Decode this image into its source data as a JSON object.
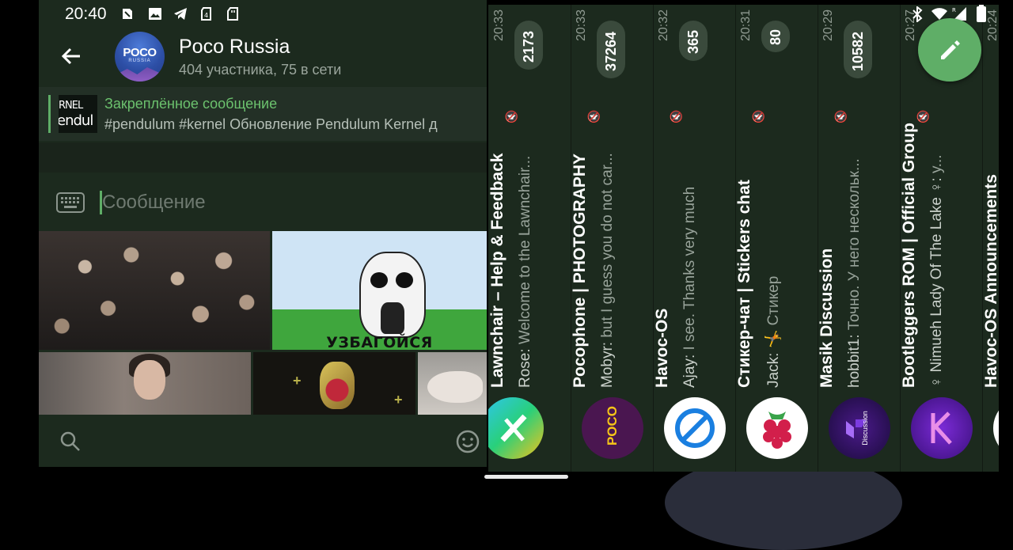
{
  "status_left": {
    "time": "20:40"
  },
  "chat": {
    "title": "Poco Russia",
    "subtitle": "404 участника, 75 в сети",
    "avatar_text": "POCO",
    "avatar_subtext": "RUSSIA"
  },
  "pinned": {
    "title": "Закреплённое сообщение",
    "text": "#pendulum #kernel  Обновление Pendulum Kernel д",
    "thumb_line1": "RNEL",
    "thumb_line2": "endul"
  },
  "composer": {
    "placeholder": "Сообщение"
  },
  "gifs": {
    "caption": "УЗБАГОЙСЯ"
  },
  "chat_list": [
    {
      "name": "Lawnchair – Help & Feedback",
      "sender": "Rose:",
      "preview": "Welcome to the Lawnchair...",
      "time": "20:33",
      "badge": "2173"
    },
    {
      "name": "Pocophone | PHOTOGRAPHY",
      "sender": "Mobyr:",
      "preview": "but I guess you do not car...",
      "time": "20:33",
      "badge": "37264"
    },
    {
      "name": "Havoc-OS",
      "sender": "Ajay:",
      "preview": "I see. Thanks very much",
      "time": "20:32",
      "badge": "365"
    },
    {
      "name": "Стикер-чат | Stickers chat",
      "sender": "Jack:",
      "preview": "🤸 Стикер",
      "time": "20:31",
      "badge": "80"
    },
    {
      "name": "Masik Discussion",
      "sender": "hobbit1:",
      "preview": "Точно. У него нескольк...",
      "time": "20:29",
      "badge": "10582"
    },
    {
      "name": "Bootleggers ROM | Official Group",
      "sender": "♀ Nimueh Lady Of The Lake ♀:",
      "preview": "у...",
      "time": "20:27",
      "badge": ""
    },
    {
      "name": "Havoc-OS Announcements",
      "sender": "",
      "preview": "",
      "time": "20:24",
      "badge": ""
    }
  ],
  "avatar_labels": {
    "poco_photo": "POCO",
    "masik": "Discussion"
  },
  "colors": {
    "accent": "#5fae67",
    "bg": "#1c2a1e",
    "badge": "#3a4a3c"
  }
}
